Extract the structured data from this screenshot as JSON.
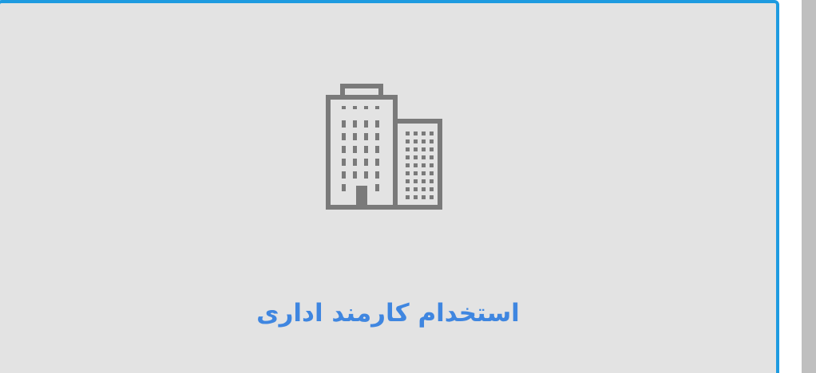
{
  "card": {
    "label": "استخدام کارمند اداری",
    "icon": "office-building-icon",
    "border_color": "#1e9be0",
    "background_color": "#e3e3e3",
    "label_color": "#3f86e0",
    "icon_color": "#7a7a7a"
  }
}
